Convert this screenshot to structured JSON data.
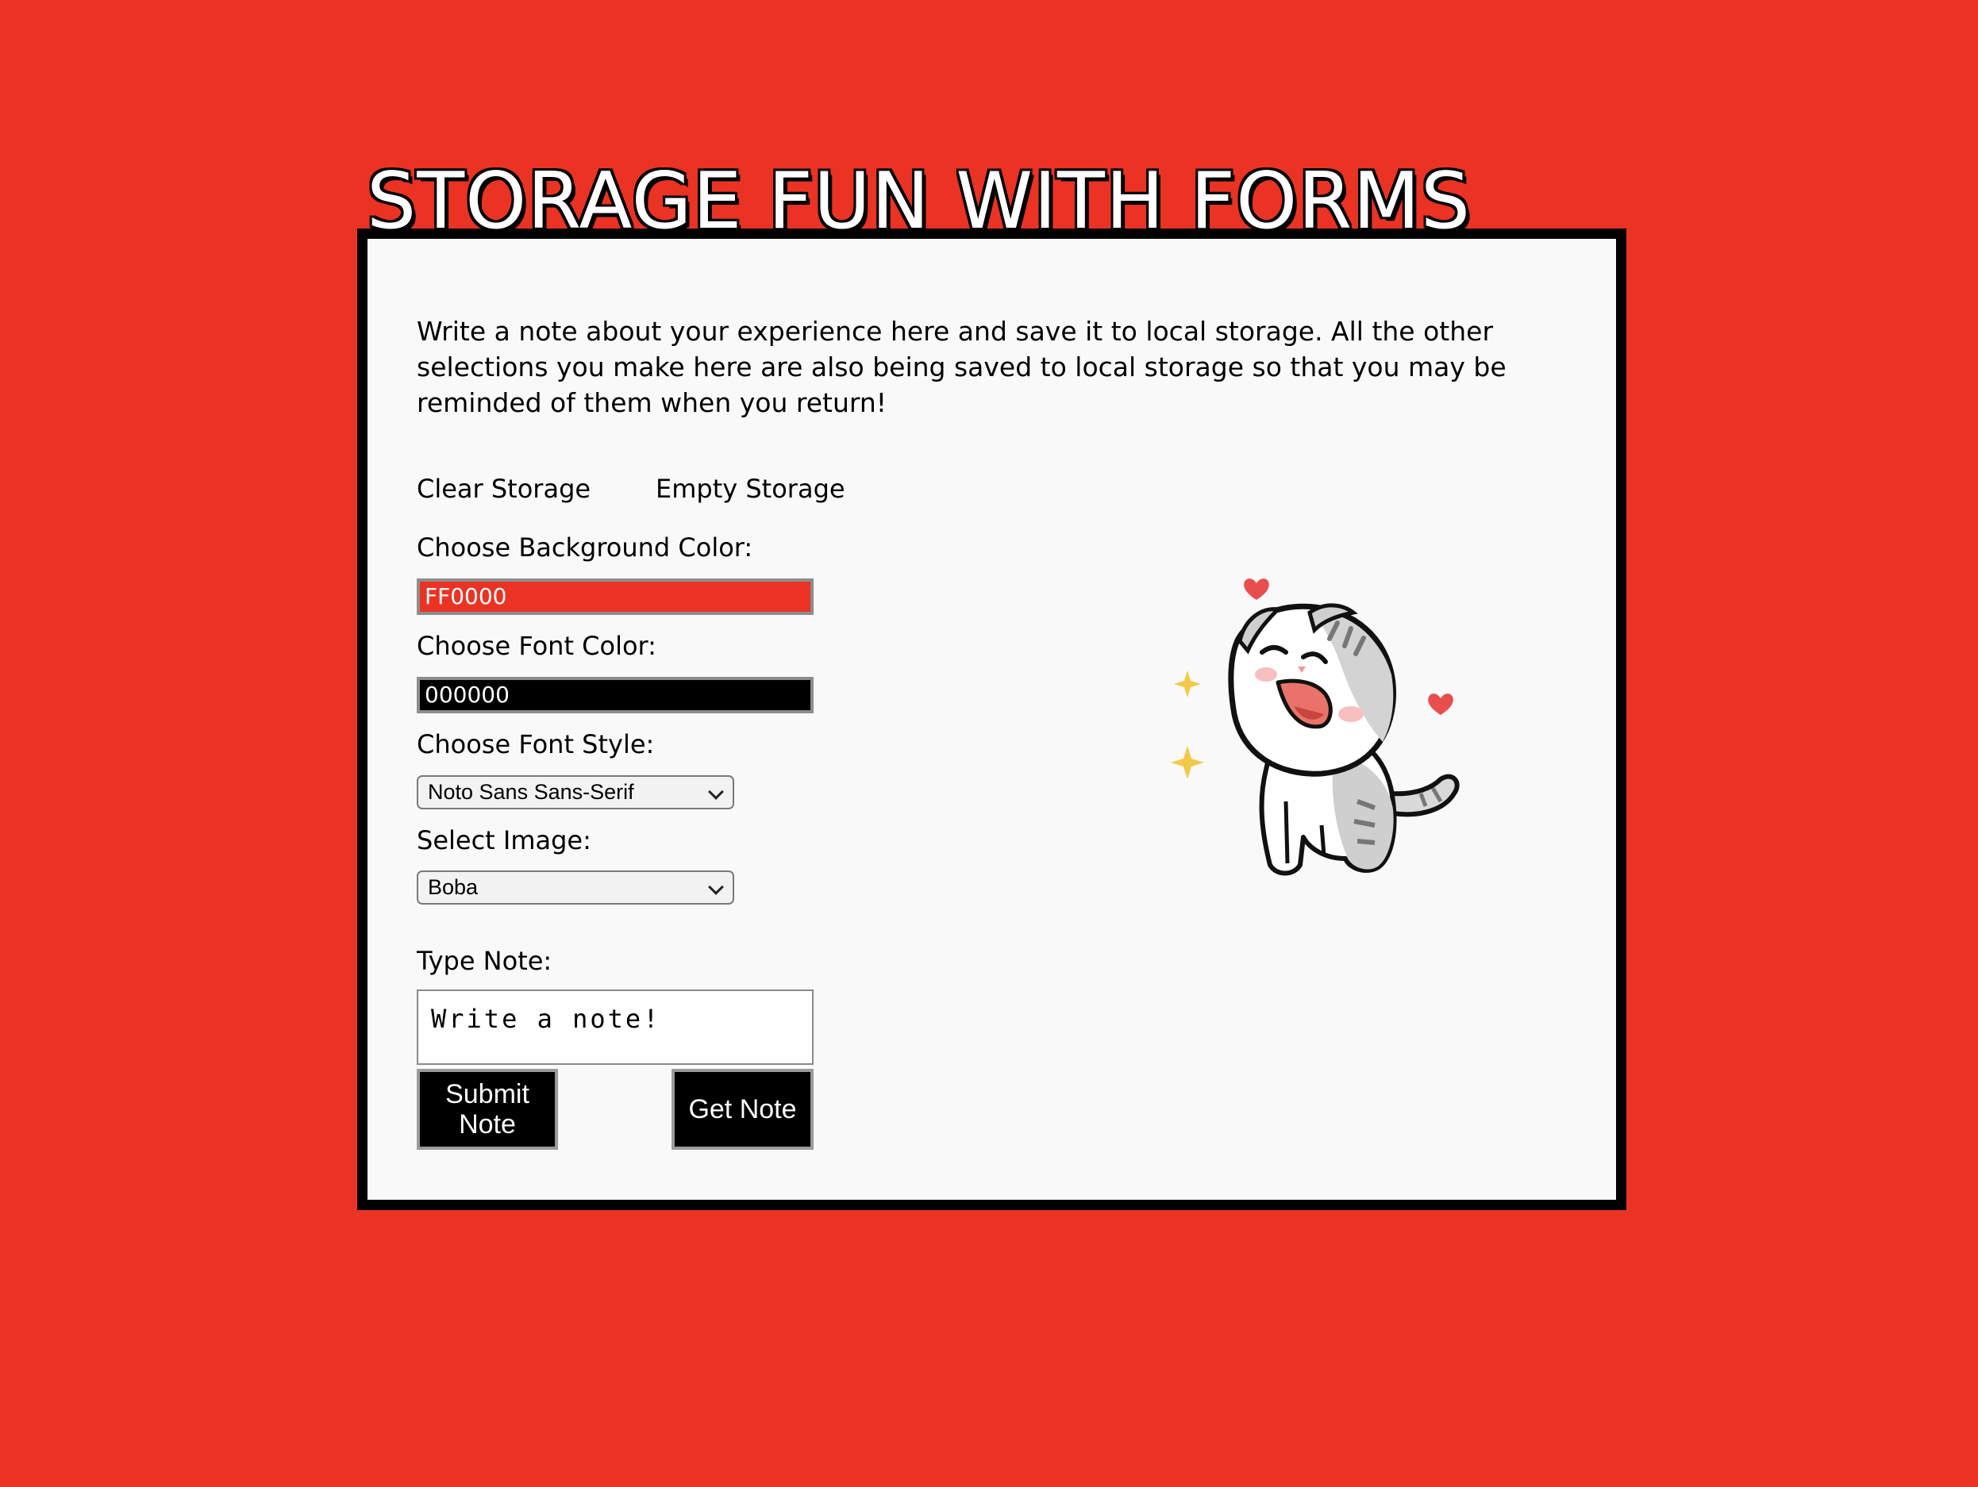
{
  "title": "STORAGE FUN WITH FORMS",
  "intro": "Write a note about your experience here and save it to local storage. All the other selections you make here are also being saved to local storage so that you may be reminded of them when you return!",
  "links": {
    "clear": "Clear Storage",
    "empty": "Empty Storage"
  },
  "background": {
    "label": "Choose Background Color:",
    "value": "FF0000",
    "swatch": "#ea3323"
  },
  "font_color": {
    "label": "Choose Font Color:",
    "value": "000000",
    "swatch": "#000000"
  },
  "font_style": {
    "label": "Choose Font Style:",
    "selected": "Noto Sans Sans-Serif"
  },
  "image": {
    "label": "Select Image:",
    "selected": "Boba",
    "icon": "cat-sticker-icon"
  },
  "note": {
    "label": "Type Note:",
    "value": "Write a note!"
  },
  "buttons": {
    "submit": "Submit Note",
    "get": "Get Note"
  }
}
